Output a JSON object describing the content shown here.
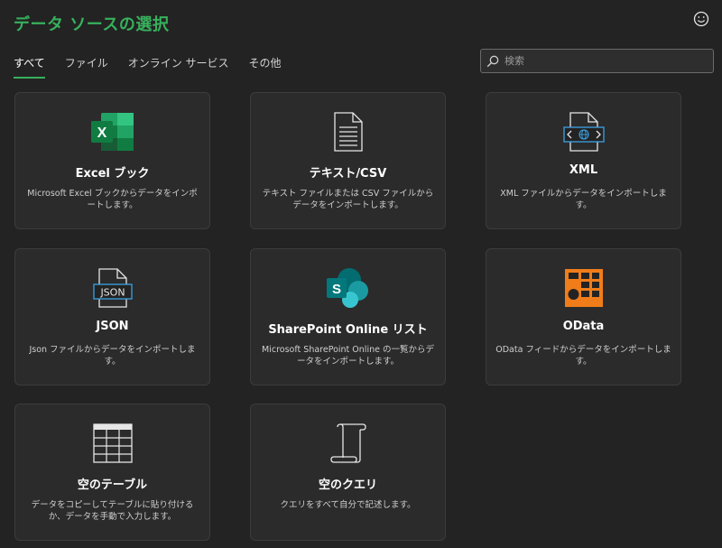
{
  "header": {
    "title": "データ ソースの選択",
    "feedback_icon": "smiley-icon"
  },
  "tabs": [
    {
      "label": "すべて",
      "active": true
    },
    {
      "label": "ファイル",
      "active": false
    },
    {
      "label": "オンライン サービス",
      "active": false
    },
    {
      "label": "その他",
      "active": false
    }
  ],
  "search": {
    "placeholder": "検索",
    "value": ""
  },
  "cards": [
    {
      "title": "Excel ブック",
      "description": "Microsoft Excel ブックからデータをインポートします。",
      "icon": "excel-icon"
    },
    {
      "title": "テキスト/CSV",
      "description": "テキスト ファイルまたは CSV ファイルからデータをインポートします。",
      "icon": "text-file-icon"
    },
    {
      "title": "XML",
      "description": "XML ファイルからデータをインポートします。",
      "icon": "xml-file-icon"
    },
    {
      "title": "JSON",
      "description": "Json ファイルからデータをインポートします。",
      "icon": "json-file-icon"
    },
    {
      "title": "SharePoint Online リスト",
      "description": "Microsoft SharePoint Online の一覧からデータをインポートします。",
      "icon": "sharepoint-icon"
    },
    {
      "title": "OData",
      "description": "OData フィードからデータをインポートします。",
      "icon": "odata-icon"
    },
    {
      "title": "空のテーブル",
      "description": "データをコピーしてテーブルに貼り付けるか、データを手動で入力します。",
      "icon": "blank-table-icon"
    },
    {
      "title": "空のクエリ",
      "description": "クエリをすべて自分で記述します。",
      "icon": "blank-query-icon"
    }
  ],
  "colors": {
    "accent": "#37b15c",
    "background": "#232323",
    "card": "#2b2b2b",
    "odata": "#f07d1a"
  }
}
